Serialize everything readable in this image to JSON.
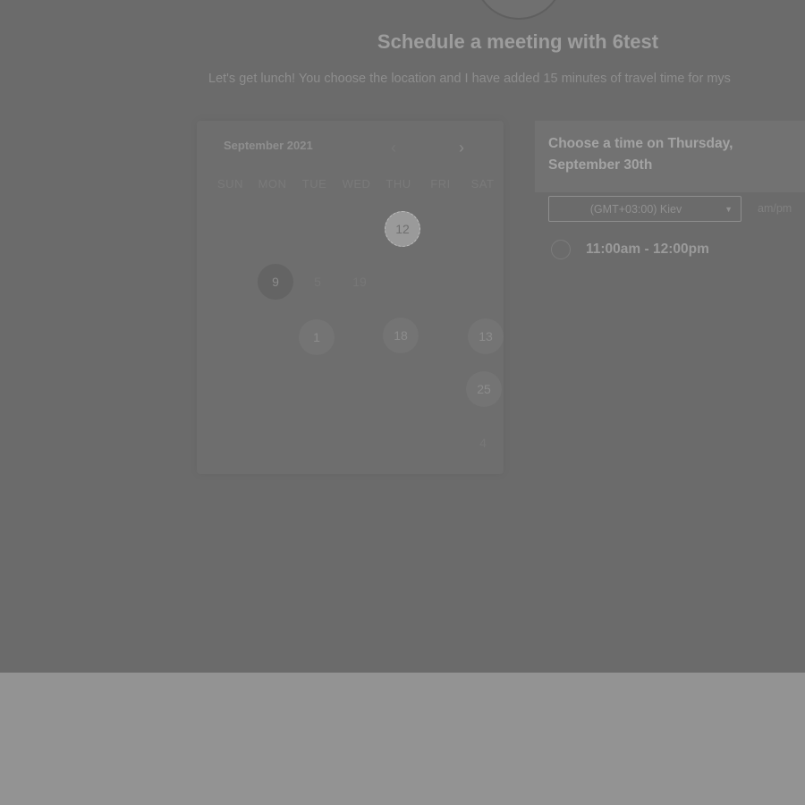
{
  "header": {
    "title": "Schedule a meeting with 6test",
    "description": "Let's get lunch! You choose the location and I have added 15 minutes of travel time for mys"
  },
  "calendar": {
    "month_label": "September 2021",
    "prev_icon": "chevron-left-icon",
    "next_icon": "chevron-right-icon",
    "weekdays": [
      "SUN",
      "MON",
      "TUE",
      "WED",
      "THU",
      "FRI",
      "SAT"
    ],
    "days": [
      {
        "label": "12",
        "state": "selected"
      },
      {
        "label": "9",
        "state": "today"
      },
      {
        "label": "5",
        "state": "dim"
      },
      {
        "label": "19",
        "state": "dim"
      },
      {
        "label": "1",
        "state": "available"
      },
      {
        "label": "18",
        "state": "available"
      },
      {
        "label": "13",
        "state": "available"
      },
      {
        "label": "25",
        "state": "available"
      },
      {
        "label": "4",
        "state": "dim"
      }
    ]
  },
  "times": {
    "heading": "Choose a time on Thursday, September 30th",
    "timezone": "(GMT+03:00) Kiev",
    "timezone_caret": "caret-down-icon",
    "format_label": "am/pm",
    "slots": [
      {
        "label": "11:00am - 12:00pm"
      }
    ]
  },
  "colors": {
    "overlay": "#6b6b6b",
    "page_background": "#939393"
  }
}
